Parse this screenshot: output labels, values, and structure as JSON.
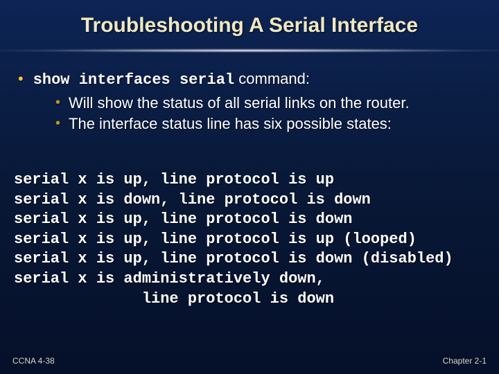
{
  "title": "Troubleshooting A Serial Interface",
  "bullet1": {
    "cmd": "show interfaces serial",
    "suffix": " command:"
  },
  "sub": {
    "a": "Will show the status of all serial links on the router.",
    "b": "The interface status line has six possible states:"
  },
  "states": {
    "l1": "serial x is up, line protocol is up",
    "l2": "serial x is down, line protocol is down",
    "l3": "serial x is up, line protocol is down",
    "l4": "serial x is up, line protocol is up (looped)",
    "l5": "serial x is up, line protocol is down (disabled)",
    "l6": "serial x is administratively down,",
    "l7": "              line protocol is down"
  },
  "footer": {
    "left": "CCNA 4-38",
    "right": "Chapter 2-1"
  }
}
